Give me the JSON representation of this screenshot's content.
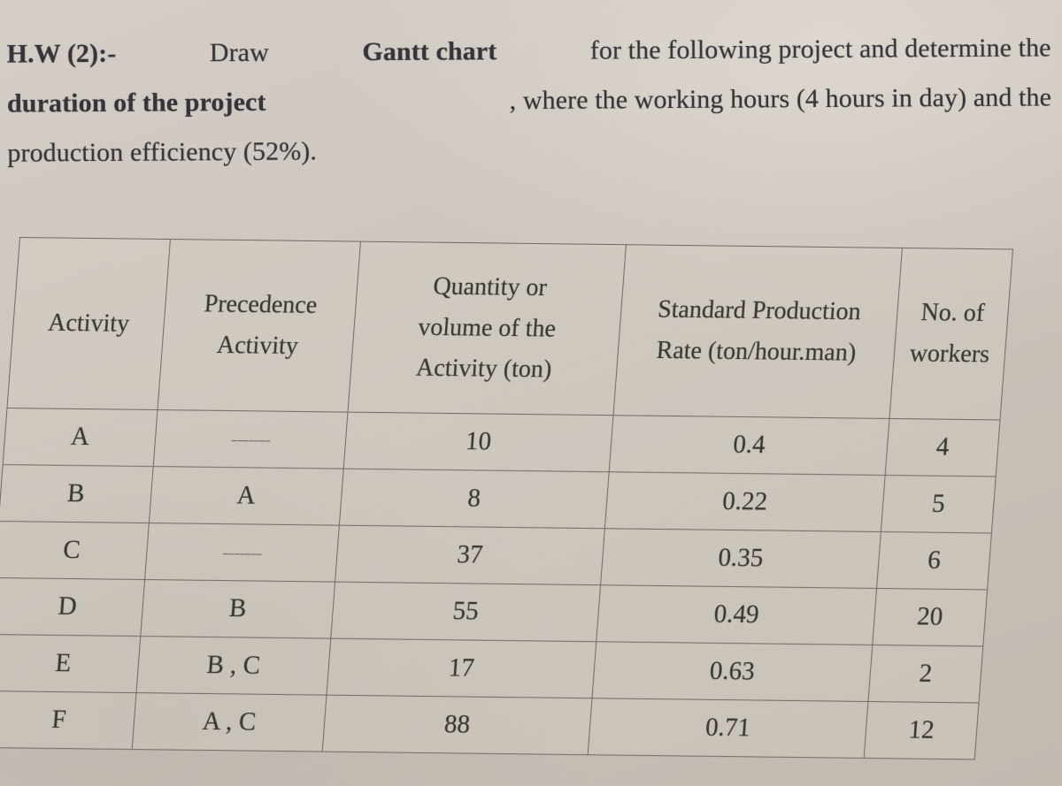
{
  "document": {
    "prompt": {
      "line1_bold_a": "H.W (2):-",
      "line1_plain_a": " Draw ",
      "line1_bold_b": "Gantt chart",
      "line1_plain_b": " for the following project and determine the",
      "line2_bold": "duration of the project",
      "line2_plain": ", where the working hours (4 hours in day) and the",
      "line3": "production efficiency (52%).",
      "full_text": "H.W (2):- Draw Gantt chart for the following project and determine the duration of the project, where the working hours (4 hours in day) and the production efficiency (52%)."
    },
    "table": {
      "headers": {
        "activity": "Activity",
        "precedence_l1": "Precedence",
        "precedence_l2": "Activity",
        "quantity_l1": "Quantity or",
        "quantity_l2": "volume of the",
        "quantity_l3": "Activity (ton)",
        "rate_l1": "Standard Production",
        "rate_l2": "Rate (ton/hour.man)",
        "workers_l1": "No. of",
        "workers_l2": "workers"
      },
      "rows": [
        {
          "activity": "A",
          "precedence": "-------",
          "quantity": "10",
          "rate": "0.4",
          "workers": "4"
        },
        {
          "activity": "B",
          "precedence": "A",
          "quantity": "8",
          "rate": "0.22",
          "workers": "5"
        },
        {
          "activity": "C",
          "precedence": "-------",
          "quantity": "37",
          "rate": "0.35",
          "workers": "6"
        },
        {
          "activity": "D",
          "precedence": "B",
          "quantity": "55",
          "rate": "0.49",
          "workers": "20"
        },
        {
          "activity": "E",
          "precedence": "B , C",
          "quantity": "17",
          "rate": "0.63",
          "workers": "2"
        },
        {
          "activity": "F",
          "precedence": "A , C",
          "quantity": "88",
          "rate": "0.71",
          "workers": "12"
        }
      ]
    },
    "colors": {
      "paper": "#cdc6be",
      "ink": "#3a3834",
      "rule": "#6f6a64"
    }
  }
}
